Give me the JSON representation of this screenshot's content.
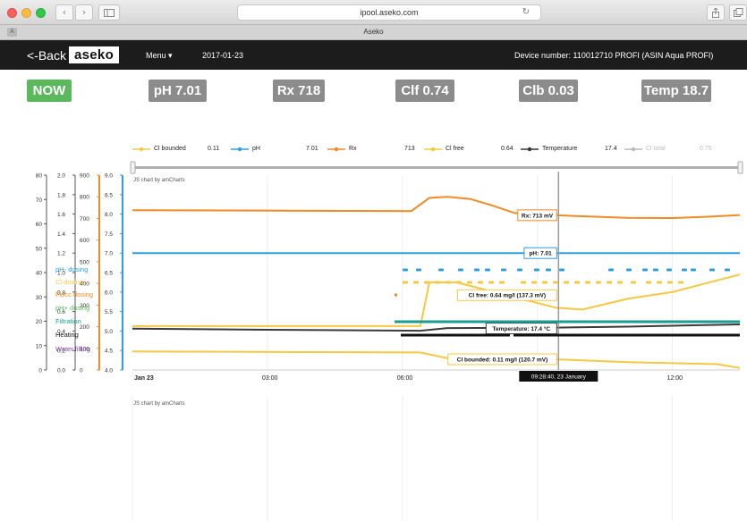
{
  "browser": {
    "url": "ipool.aseko.com",
    "tab_title": "Aseko",
    "tab_icon": "A"
  },
  "header": {
    "back_label": "<-Back",
    "logo": "aseko",
    "menu_label": "Menu ▾",
    "date": "2017-01-23",
    "device": "Device number: 110012710 PROFI (ASIN Aqua PROFI)"
  },
  "status": {
    "now": "NOW",
    "ph": "pH 7.01",
    "rx": "Rx 718",
    "clf": "Clf 0.74",
    "clb": "Clb 0.03",
    "temp": "Temp 18.7"
  },
  "legend": [
    {
      "name": "Cl bounded",
      "value": "0.11",
      "color": "#f5c842"
    },
    {
      "name": "pH",
      "value": "7.01",
      "color": "#2f9de0"
    },
    {
      "name": "Rx",
      "value": "713",
      "color": "#f08a24"
    },
    {
      "name": "Cl free",
      "value": "0.64",
      "color": "#f5c842"
    },
    {
      "name": "Temperature",
      "value": "17.4",
      "color": "#333333"
    },
    {
      "name": "Cl total",
      "value": "0.75",
      "color": "#bbbbbb"
    }
  ],
  "credit": "JS chart by amCharts",
  "axis_ticks": {
    "temp": [
      "0",
      "10",
      "20",
      "30",
      "40",
      "50",
      "60",
      "70",
      "80"
    ],
    "cl": [
      "0.0",
      "0.2",
      "0.4",
      "0.6",
      "0.8",
      "1.0",
      "1.2",
      "1.4",
      "1.6",
      "1.8",
      "2.0"
    ],
    "rx": [
      "0",
      "100",
      "200",
      "300",
      "400",
      "500",
      "600",
      "700",
      "800",
      "900"
    ],
    "ph": [
      "4.0",
      "4.5",
      "5.0",
      "5.5",
      "6.0",
      "6.5",
      "7.0",
      "7.5",
      "8.0",
      "8.5",
      "9.0"
    ]
  },
  "chart_data": {
    "type": "line",
    "x_axis_labels": [
      "Jan 23",
      "03:00",
      "06:00",
      "12:00"
    ],
    "cursor_time": "09:28:40, 23 January",
    "series": [
      {
        "name": "Rx",
        "axis": "rx",
        "color": "#f08a24",
        "x": [
          0,
          5,
          6.2,
          6.6,
          7,
          7.5,
          8,
          8.5,
          9.4,
          10,
          11,
          12,
          12.8,
          13.5
        ],
        "values": [
          738,
          735,
          734,
          795,
          800,
          790,
          760,
          725,
          715,
          710,
          703,
          702,
          708,
          716
        ]
      },
      {
        "name": "pH",
        "axis": "ph",
        "color": "#2f9de0",
        "x": [
          0,
          3,
          6,
          9.4,
          11,
          13.5
        ],
        "values": [
          7.0,
          7.0,
          7.0,
          7.0,
          7.0,
          7.0
        ]
      },
      {
        "name": "Cl free",
        "axis": "cl",
        "color": "#f5c842",
        "x": [
          0,
          6.4,
          6.6,
          7.2,
          9.4,
          10,
          11,
          12,
          13,
          13.5
        ],
        "values": [
          0.45,
          0.45,
          0.9,
          0.9,
          0.64,
          0.62,
          0.73,
          0.8,
          0.92,
          0.98
        ]
      },
      {
        "name": "Temperature",
        "axis": "temp",
        "color": "#3a3a3a",
        "x": [
          0,
          3,
          6.4,
          7,
          9.4,
          11,
          13.5
        ],
        "values": [
          17.0,
          16.5,
          16.1,
          17.2,
          17.4,
          17.8,
          18.7
        ]
      },
      {
        "name": "Cl bounded",
        "axis": "cl",
        "color": "#f5c842",
        "x": [
          0,
          6.4,
          7,
          9.4,
          11,
          13,
          13.5
        ],
        "values": [
          0.19,
          0.18,
          0.12,
          0.11,
          0.08,
          0.06,
          0.02
        ]
      }
    ],
    "balloons": [
      {
        "text": "Rx: 713 mV",
        "series": "Rx"
      },
      {
        "text": "pH: 7.01",
        "series": "pH"
      },
      {
        "text": "Cl free: 0.64 mg/l (137.3 mV)",
        "series": "Cl free"
      },
      {
        "text": "Temperature: 17.4 °C",
        "series": "Temperature"
      },
      {
        "text": "Cl bounded: 0.11 mg/l (120.7 mV)",
        "series": "Cl bounded"
      }
    ],
    "ylim": {
      "temp": [
        0,
        80
      ],
      "cl": [
        0,
        2.0
      ],
      "rx": [
        0,
        900
      ],
      "ph": [
        4.0,
        9.0
      ]
    },
    "xlim": [
      0,
      13.5
    ],
    "cursor_x": 9.47
  },
  "dosing": [
    {
      "name": "pH- dosing",
      "color": "#2f9de0"
    },
    {
      "name": "Cl dosing",
      "color": "#f5c842"
    },
    {
      "name": "Flocc dosing",
      "color": "#f08a24"
    },
    {
      "name": "pH+ dosing",
      "color": "#5cb85c"
    },
    {
      "name": "Filtration",
      "color": "#1a9e8f"
    },
    {
      "name": "Heating",
      "color": "#111111"
    },
    {
      "name": "Water filling",
      "color": "#7b3fb0"
    }
  ]
}
